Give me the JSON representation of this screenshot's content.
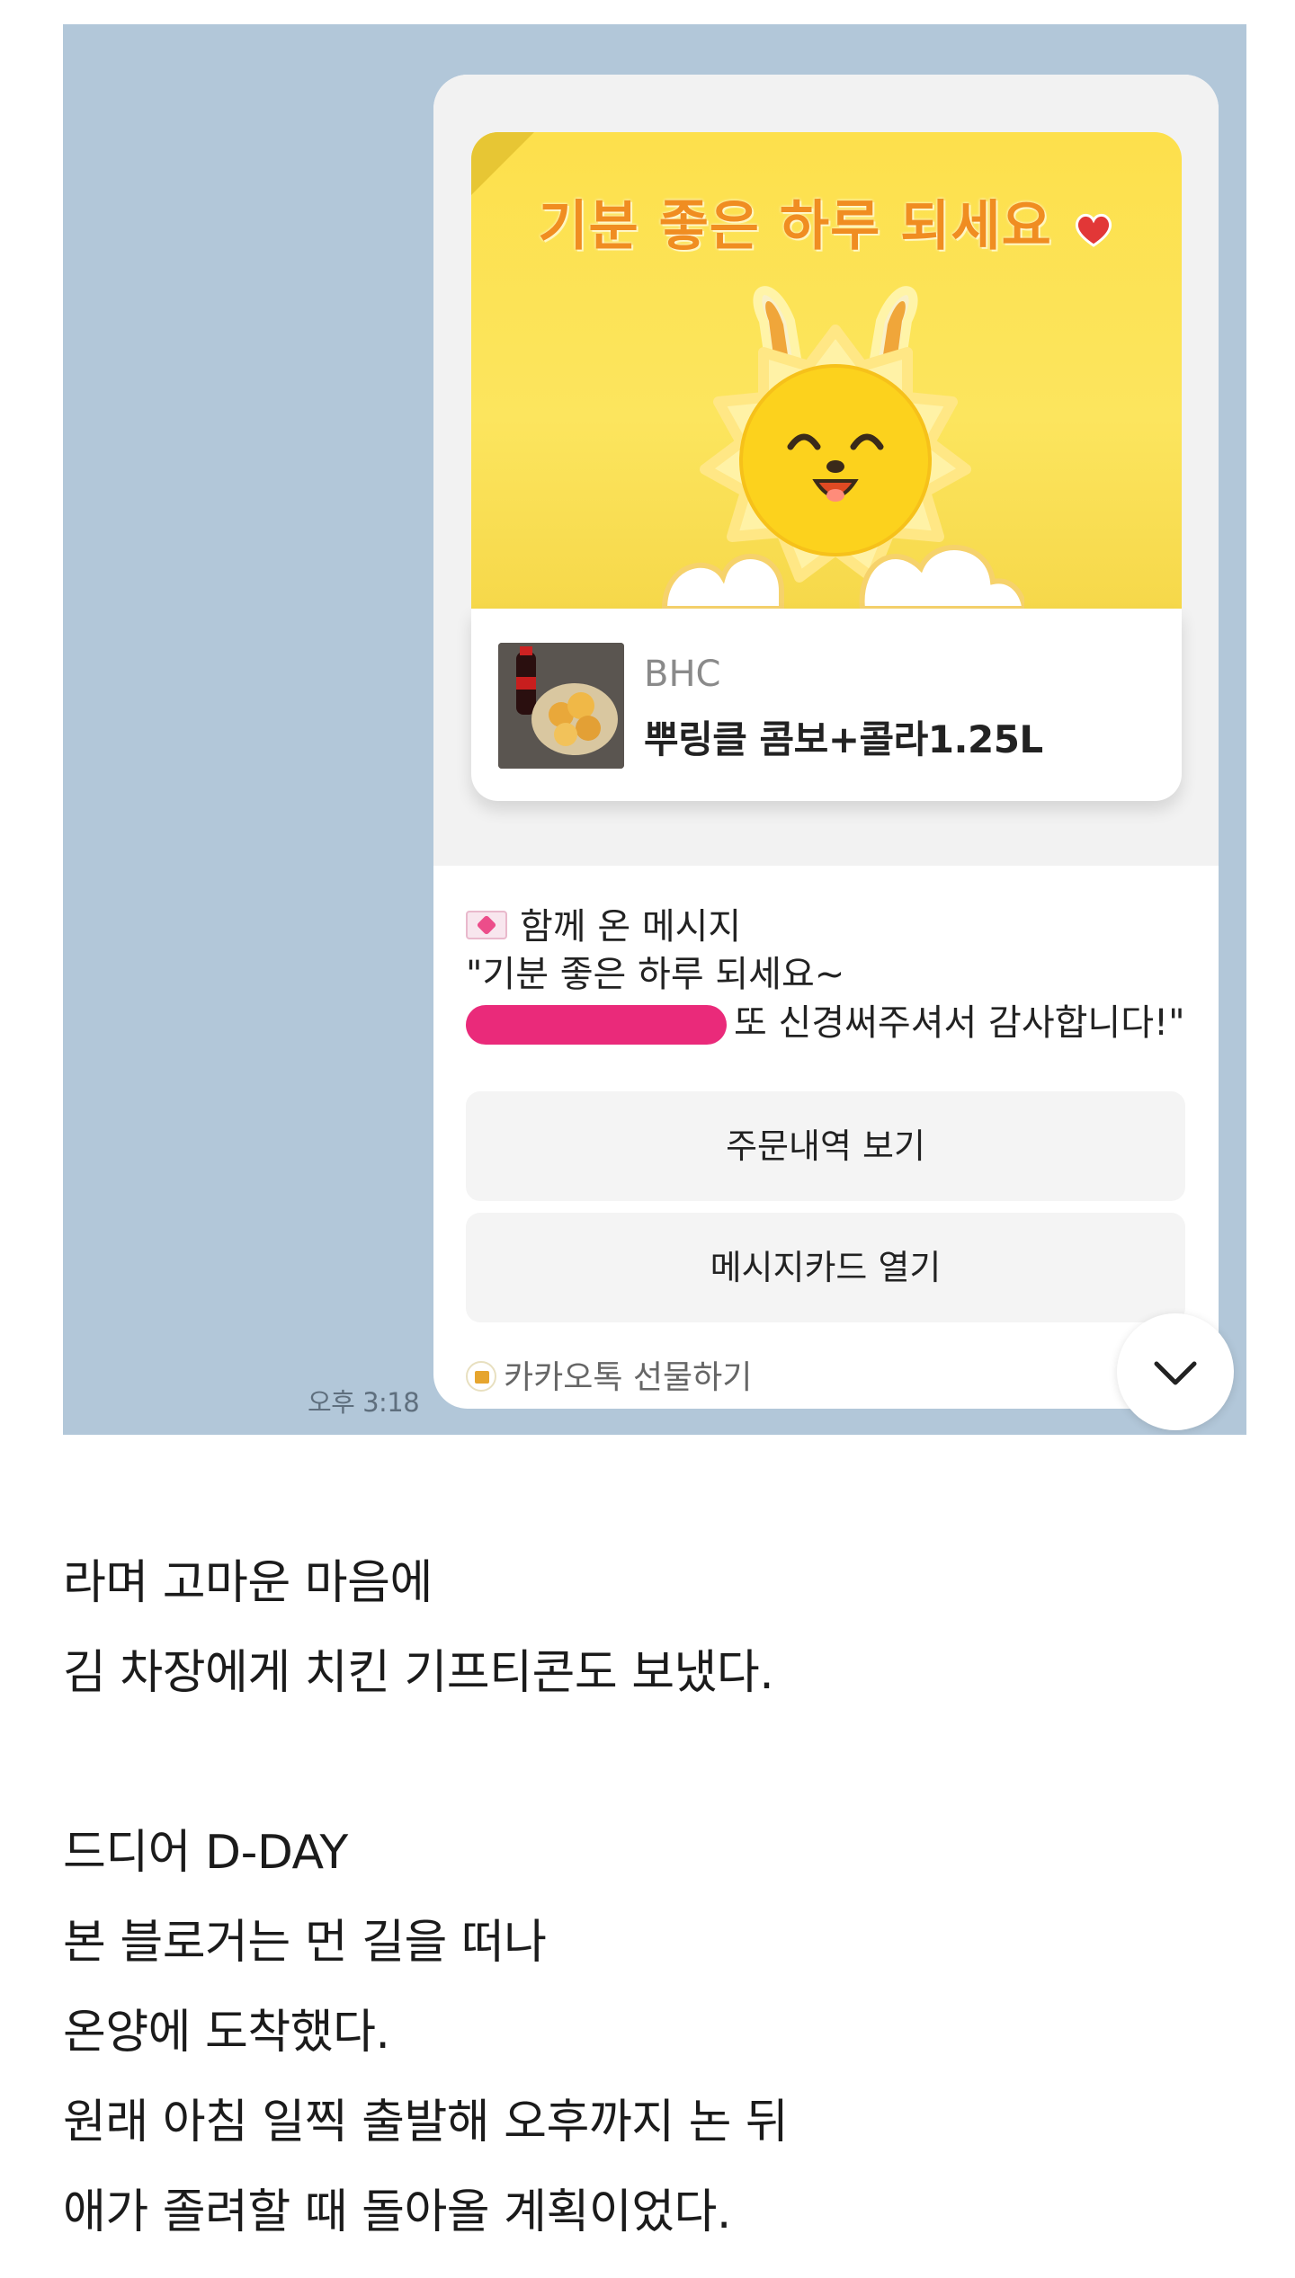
{
  "chat": {
    "time": "오후 3:18",
    "card": {
      "hero_title": "기분 좋은 하루 되세요",
      "product_brand": "BHC",
      "product_name": "뿌링클 콤보+콜라1.25L",
      "message_header": "함께 온 메시지",
      "message_line1": "\"기분 좋은 하루 되세요~",
      "message_line2": "또 신경써주셔서 감사합니다!\"",
      "button_order": "주문내역 보기",
      "button_card": "메시지카드 열기",
      "footer": "카카오톡 선물하기"
    }
  },
  "blog": {
    "lines": [
      "라며 고마운 마음에",
      "김 차장에게 치킨 기프티콘도 보냈다.",
      "드디어 D-DAY",
      "본 블로거는 먼 길을 떠나",
      "온양에 도착했다.",
      "원래 아침 일찍 출발해 오후까지 논 뒤",
      "애가 졸려할 때 돌아올 계획이었다."
    ]
  },
  "colors": {
    "chat_background": "#b2c7d9",
    "hero_yellow": "#fde04c",
    "hero_title": "#f08d21",
    "redaction": "#ea2a7a"
  }
}
